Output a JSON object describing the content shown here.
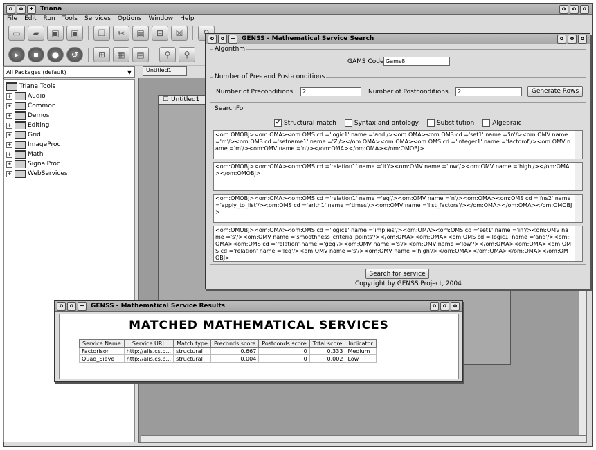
{
  "main_window": {
    "title": "Triana",
    "menu": [
      "File",
      "Edit",
      "Run",
      "Tools",
      "Services",
      "Options",
      "Window",
      "Help"
    ],
    "package_combo": "All Packages (default)",
    "tree_root": "Triana Tools",
    "tree_items": [
      "Audio",
      "Common",
      "Demos",
      "Editing",
      "Grid",
      "ImageProc",
      "Math",
      "SignalProc",
      "WebServices"
    ],
    "tab_label": "Untitled1",
    "inner_window_title": "Untitled1"
  },
  "search_window": {
    "title": "GENSS - Mathematical Service Search",
    "algorithm_group": "Algorithm",
    "gams_label": "GAMS Code",
    "gams_value": "Gams8",
    "conditions_group": "Number of Pre- and Post-conditions",
    "precond_label": "Number of Preconditions",
    "precond_value": "2",
    "postcond_label": "Number of Postconditions",
    "postcond_value": "2",
    "generate_button": "Generate Rows",
    "searchfor_group": "SearchFor",
    "options": [
      {
        "label": "Structural match",
        "checked": true
      },
      {
        "label": "Syntax and ontology",
        "checked": false
      },
      {
        "label": "Substitution",
        "checked": false
      },
      {
        "label": "Algebraic",
        "checked": false
      }
    ],
    "rows": [
      "<om:OMOBJ><om:OMA><om:OMS cd ='logic1' name ='and'/><om:OMA><om:OMS cd ='set1' name ='in'/><om:OMV name ='m'/><om:OMS cd ='setname1' name ='Z'/></om:OMA><om:OMA><om:OMS cd ='integer1' name ='factorof'/><om:OMV name ='m'/><om:OMV name ='n'/></om:OMA></om:OMA></om:OMOBJ>",
      "<om:OMOBJ><om:OMA><om:OMS cd ='relation1' name ='lt'/><om:OMV name ='low'/><om:OMV name ='high'/></om:OMA></om:OMOBJ>",
      "<om:OMOBJ><om:OMA><om:OMS cd ='relation1' name ='eq'/><om:OMV name ='n'/><om:OMA><om:OMS cd ='fns2' name ='apply_to_list'/><om:OMS cd ='arith1' name ='times'/><om:OMV name ='list_factors'/></om:OMA></om:OMA></om:OMOBJ>",
      "<om:OMOBJ><om:OMA><om:OMS cd ='logic1' name ='implies'/><om:OMA><om:OMS cd ='set1' name ='in'/><om:OMV name ='s'/><om:OMV name ='smoothness_criteria_points'/></om:OMA><om:OMA><om:OMS cd ='logic1' name ='and'/><om:OMA><om:OMS cd ='relation' name ='geq'/><om:OMV name ='s'/><om:OMV name ='low'/></om:OMA><om:OMA><om:OMS cd ='relation' name ='leq'/><om:OMV name ='s'/><om:OMV name ='high'/></om:OMA></om:OMA></om:OMA></om:OMOBJ>"
    ],
    "search_button": "Search for service",
    "copyright": "Copyright by GENSS Project, 2004"
  },
  "results_window": {
    "title": "GENSS - Mathematical Service Results",
    "heading": "MATCHED MATHEMATICAL SERVICES",
    "columns": [
      "Service Name",
      "Service URL",
      "Match type",
      "Preconds score",
      "Postconds score",
      "Total score",
      "Indicator"
    ],
    "rows": [
      [
        "Factorisor",
        "http://alis.cs.b...",
        "structural",
        "0.667",
        "0",
        "0.333",
        "Medium"
      ],
      [
        "Quad_Sieve",
        "http://alis.cs.b...",
        "structural",
        "0.004",
        "0",
        "0.002",
        "Low"
      ]
    ]
  }
}
